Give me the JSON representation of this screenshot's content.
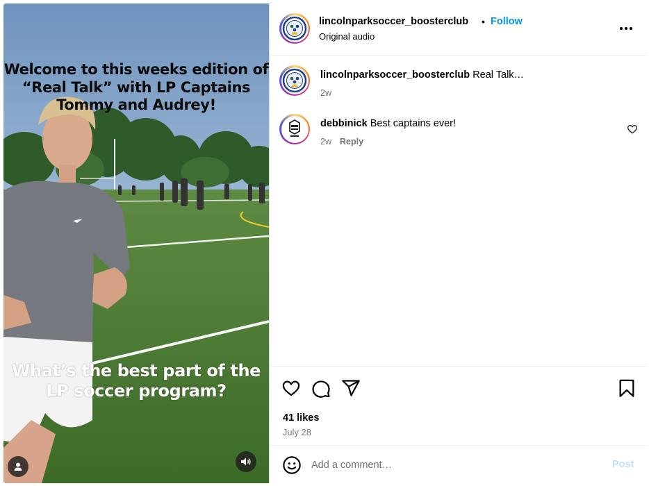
{
  "media": {
    "caption_top": "Welcome to this weeks edition of “Real Talk” with LP Captains Tommy and Audrey!",
    "caption_bottom": "What’s the best part of the LP soccer program?",
    "user_icon": "user-icon",
    "audio_icon": "speaker-icon"
  },
  "header": {
    "username": "lincolnparksoccer_boosterclub",
    "separator": "•",
    "follow_label": "Follow",
    "subtitle": "Original audio",
    "more_icon": "more-options-icon"
  },
  "comments": [
    {
      "username": "lincolnparksoccer_boosterclub",
      "text": "Real Talk…",
      "time": "2w",
      "reply_label": ""
    },
    {
      "username": "debbinick",
      "text": "Best captains ever!",
      "time": "2w",
      "reply_label": "Reply"
    }
  ],
  "actions": {
    "like_icon": "heart-icon",
    "comment_icon": "comment-icon",
    "share_icon": "send-icon",
    "save_icon": "bookmark-icon",
    "likes": "41 likes",
    "date": "July 28"
  },
  "composer": {
    "placeholder": "Add a comment…",
    "post_label": "Post",
    "emoji_icon": "emoji-icon"
  },
  "colors": {
    "follow": "#0095f6",
    "muted": "#737373",
    "post_disabled": "#c0dffd",
    "border": "#dbdbdb"
  }
}
